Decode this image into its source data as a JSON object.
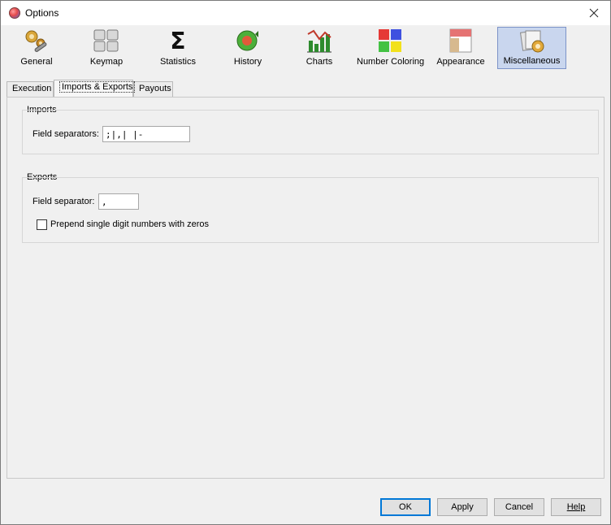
{
  "window": {
    "title": "Options"
  },
  "toolbar": {
    "items": [
      {
        "label": "General",
        "icon": "gears-wrench-icon"
      },
      {
        "label": "Keymap",
        "icon": "keyboard-keys-icon"
      },
      {
        "label": "Statistics",
        "icon": "sigma-icon"
      },
      {
        "label": "History",
        "icon": "history-refresh-icon"
      },
      {
        "label": "Charts",
        "icon": "bar-chart-icon"
      },
      {
        "label": "Number Coloring",
        "icon": "color-grid-icon"
      },
      {
        "label": "Appearance",
        "icon": "layout-panels-icon"
      },
      {
        "label": "Miscellaneous",
        "icon": "documents-gear-icon"
      }
    ],
    "selected": "Miscellaneous"
  },
  "tabs": [
    {
      "label": "Execution"
    },
    {
      "label": "Imports & Exports"
    },
    {
      "label": "Payouts"
    }
  ],
  "active_tab": "Imports & Exports",
  "imports": {
    "title": "Imports",
    "field_separators_label": "Field separators:",
    "field_separators_value": ";|,| |-"
  },
  "exports": {
    "title": "Exports",
    "field_separator_label": "Field separator:",
    "field_separator_value": ",",
    "prepend_zeros_label": "Prepend single digit numbers with zeros",
    "prepend_zeros_checked": false
  },
  "buttons": {
    "ok": "OK",
    "apply": "Apply",
    "cancel": "Cancel",
    "help": "Help"
  },
  "colors": {
    "selected_bg": "#c9d6ee",
    "default_button_border": "#0078d7"
  }
}
